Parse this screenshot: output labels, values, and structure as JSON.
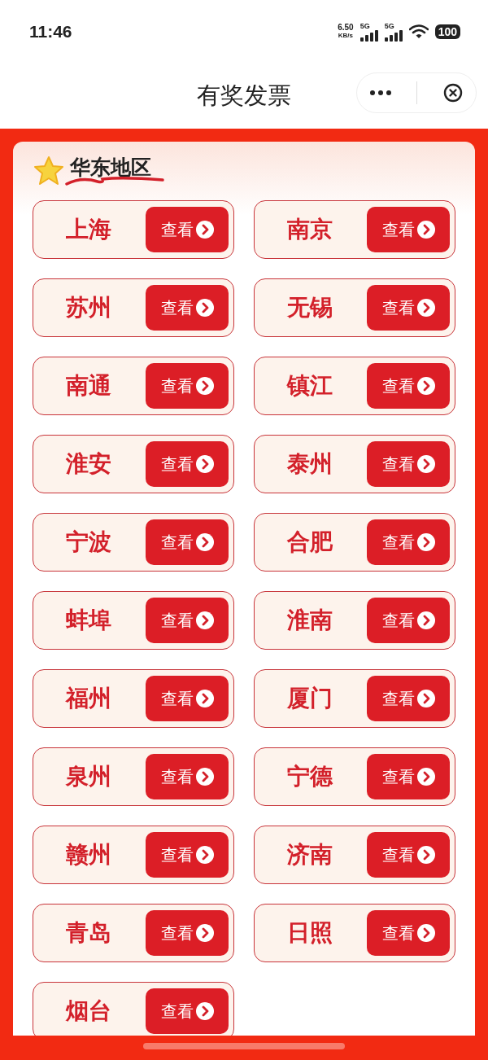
{
  "status_bar": {
    "time": "11:46",
    "net_speed": "6.50",
    "net_unit": "KB/s",
    "signal_1": "5G",
    "signal_2": "5G",
    "battery": "100"
  },
  "nav": {
    "title": "有奖发票"
  },
  "section": {
    "title": "华东地区",
    "cities": [
      {
        "name": "上海",
        "action": "查看"
      },
      {
        "name": "南京",
        "action": "查看"
      },
      {
        "name": "苏州",
        "action": "查看"
      },
      {
        "name": "无锡",
        "action": "查看"
      },
      {
        "name": "南通",
        "action": "查看"
      },
      {
        "name": "镇江",
        "action": "查看"
      },
      {
        "name": "淮安",
        "action": "查看"
      },
      {
        "name": "泰州",
        "action": "查看"
      },
      {
        "name": "宁波",
        "action": "查看"
      },
      {
        "name": "合肥",
        "action": "查看"
      },
      {
        "name": "蚌埠",
        "action": "查看"
      },
      {
        "name": "淮南",
        "action": "查看"
      },
      {
        "name": "福州",
        "action": "查看"
      },
      {
        "name": "厦门",
        "action": "查看"
      },
      {
        "name": "泉州",
        "action": "查看"
      },
      {
        "name": "宁德",
        "action": "查看"
      },
      {
        "name": "赣州",
        "action": "查看"
      },
      {
        "name": "济南",
        "action": "查看"
      },
      {
        "name": "青岛",
        "action": "查看"
      },
      {
        "name": "日照",
        "action": "查看"
      },
      {
        "name": "烟台",
        "action": "查看"
      }
    ]
  }
}
